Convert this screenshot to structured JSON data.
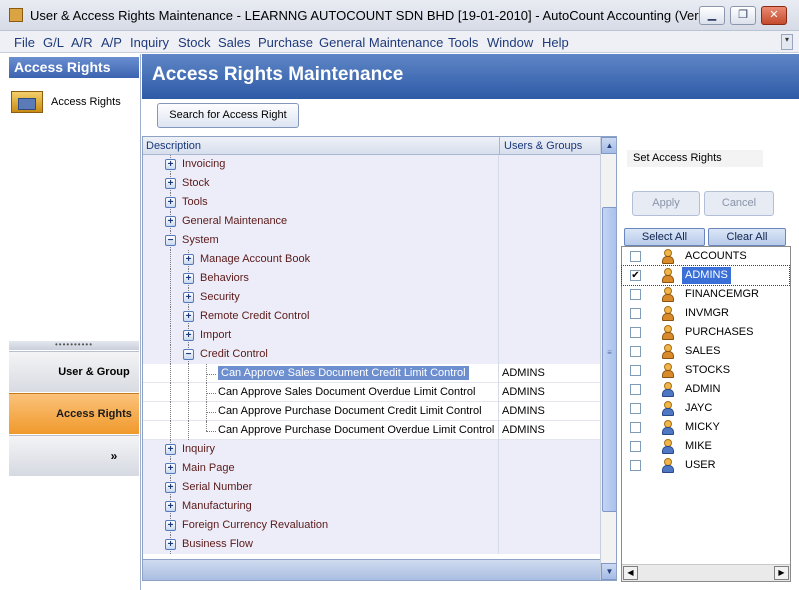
{
  "window": {
    "title": "User & Access Rights Maintenance - LEARNNG AUTOCOUNT SDN BHD [19-01-2010] - AutoCount Accounting (Ver: ..."
  },
  "menu": [
    "File",
    "G/L",
    "A/R",
    "A/P",
    "Inquiry",
    "Stock",
    "Sales",
    "Purchase",
    "General Maintenance",
    "Tools",
    "Window",
    "Help"
  ],
  "sidebar": {
    "header": "Access Rights",
    "item": "Access Rights",
    "nav_user_group": "User & Group",
    "nav_access_rights": "Access Rights",
    "nav_more": "»"
  },
  "page": {
    "title": "Access Rights Maintenance",
    "search_button": "Search for Access Right"
  },
  "grid": {
    "col_description": "Description",
    "col_users": "Users & Groups",
    "rows": [
      {
        "label": "Invoicing",
        "level": 0,
        "pm": "+",
        "users": ""
      },
      {
        "label": "Stock",
        "level": 0,
        "pm": "+",
        "users": ""
      },
      {
        "label": "Tools",
        "level": 0,
        "pm": "+",
        "users": ""
      },
      {
        "label": "General Maintenance",
        "level": 0,
        "pm": "+",
        "users": ""
      },
      {
        "label": "System",
        "level": 0,
        "pm": "-",
        "users": ""
      },
      {
        "label": "Manage Account Book",
        "level": 1,
        "pm": "+",
        "users": ""
      },
      {
        "label": "Behaviors",
        "level": 1,
        "pm": "+",
        "users": ""
      },
      {
        "label": "Security",
        "level": 1,
        "pm": "+",
        "users": ""
      },
      {
        "label": "Remote Credit Control",
        "level": 1,
        "pm": "+",
        "users": ""
      },
      {
        "label": "Import",
        "level": 1,
        "pm": "+",
        "users": ""
      },
      {
        "label": "Credit Control",
        "level": 1,
        "pm": "-",
        "users": ""
      },
      {
        "label": "Can Approve Sales Document Credit Limit Control",
        "level": 2,
        "pm": "",
        "users": "ADMINS",
        "selected": true
      },
      {
        "label": "Can Approve Sales Document Overdue Limit Control",
        "level": 2,
        "pm": "",
        "users": "ADMINS"
      },
      {
        "label": "Can Approve Purchase Document Credit Limit Control",
        "level": 2,
        "pm": "",
        "users": "ADMINS"
      },
      {
        "label": "Can Approve Purchase Document Overdue Limit Control",
        "level": 2,
        "pm": "",
        "users": "ADMINS"
      },
      {
        "label": "Inquiry",
        "level": 0,
        "pm": "+",
        "users": ""
      },
      {
        "label": "Main Page",
        "level": 0,
        "pm": "+",
        "users": ""
      },
      {
        "label": "Serial Number",
        "level": 0,
        "pm": "+",
        "users": ""
      },
      {
        "label": "Manufacturing",
        "level": 0,
        "pm": "+",
        "users": ""
      },
      {
        "label": "Foreign Currency Revaluation",
        "level": 0,
        "pm": "+",
        "users": ""
      },
      {
        "label": "Business Flow",
        "level": 0,
        "pm": "+",
        "users": ""
      }
    ]
  },
  "rights": {
    "label": "Set Access Rights",
    "apply": "Apply",
    "cancel": "Cancel",
    "select_all": "Select All",
    "clear_all": "Clear All",
    "users": [
      {
        "name": "ACCOUNTS",
        "group": true,
        "checked": false
      },
      {
        "name": "ADMINS",
        "group": true,
        "checked": true,
        "selected": true
      },
      {
        "name": "FINANCEMGR",
        "group": true,
        "checked": false
      },
      {
        "name": "INVMGR",
        "group": true,
        "checked": false
      },
      {
        "name": "PURCHASES",
        "group": true,
        "checked": false
      },
      {
        "name": "SALES",
        "group": true,
        "checked": false
      },
      {
        "name": "STOCKS",
        "group": true,
        "checked": false
      },
      {
        "name": "ADMIN",
        "group": false,
        "checked": false
      },
      {
        "name": "JAYC",
        "group": false,
        "checked": false
      },
      {
        "name": "MICKY",
        "group": false,
        "checked": false
      },
      {
        "name": "MIKE",
        "group": false,
        "checked": false
      },
      {
        "name": "USER",
        "group": false,
        "checked": false
      }
    ]
  }
}
